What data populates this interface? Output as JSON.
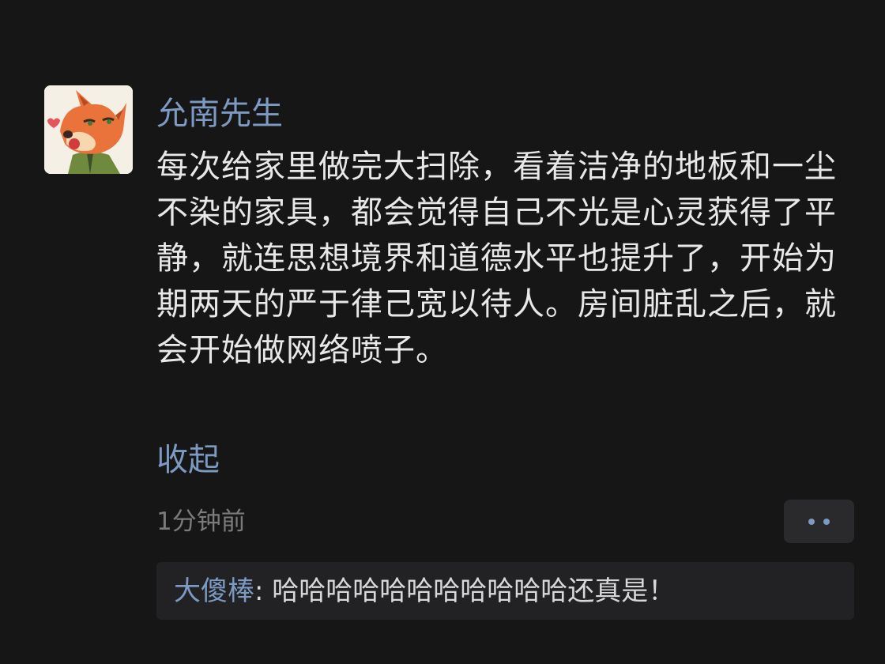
{
  "post": {
    "author": "允南先生",
    "text": "每次给家里做完大扫除，看着洁净的地板和一尘不染的家具，都会觉得自己不光是心灵获得了平静，就连思想境界和道德水平也提升了，开始为期两天的严于律己宽以待人。房间脏乱之后，就会开始做网络喷子。",
    "collapse_label": "收起",
    "timestamp": "1分钟前",
    "avatar_icon": "fox-avatar-icon",
    "more_icon": "more-dots-icon"
  },
  "comments": [
    {
      "author": "大傻棒",
      "separator": ": ",
      "text": "哈哈哈哈哈哈哈哈哈哈哈还真是！"
    }
  ],
  "colors": {
    "background": "#161616",
    "link": "#7d9ac3",
    "text": "#e8e8e8",
    "muted": "#7b7b7b",
    "comment_bg": "#222224"
  }
}
